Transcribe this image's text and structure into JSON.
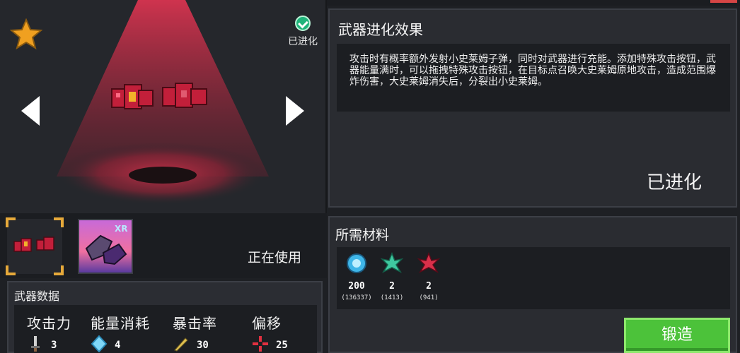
{
  "preview": {
    "evolved_label": "已进化",
    "icons": {
      "favorite": "star-icon",
      "evolved": "check-badge-icon",
      "prev": "left-arrow-icon",
      "next": "right-arrow-icon"
    }
  },
  "skins": {
    "status_label": "正在使用"
  },
  "stats": {
    "title": "武器数据",
    "items": [
      {
        "name": "攻击力",
        "value": "3",
        "icon": "sword-icon"
      },
      {
        "name": "能量消耗",
        "value": "4",
        "icon": "energy-crystal-icon"
      },
      {
        "name": "暴击率",
        "value": "30",
        "icon": "crit-blade-icon"
      },
      {
        "name": "偏移",
        "value": "25",
        "icon": "crosshair-icon"
      }
    ]
  },
  "effect": {
    "title": "武器进化效果",
    "description": "攻击时有概率额外发射小史莱姆子弹，同时对武器进行充能。添加特殊攻击按钮，武器能量满时，可以拖拽特殊攻击按钮，在目标点召唤大史莱姆原地攻击，造成范围爆炸伤害，大史莱姆消失后，分裂出小史莱姆。",
    "status": "已进化"
  },
  "materials": {
    "title": "所需材料",
    "items": [
      {
        "amount": "200",
        "owned": "(136337)",
        "icon": "blue-gem-icon"
      },
      {
        "amount": "2",
        "owned": "(1413)",
        "icon": "green-leaf-icon"
      },
      {
        "amount": "2",
        "owned": "(941)",
        "icon": "red-leaf-icon"
      }
    ],
    "forge_label": "锻造"
  },
  "colors": {
    "accent_green": "#4cc23a",
    "spotlight_red": "#d8344e",
    "corner_gold": "#e6a93a"
  }
}
